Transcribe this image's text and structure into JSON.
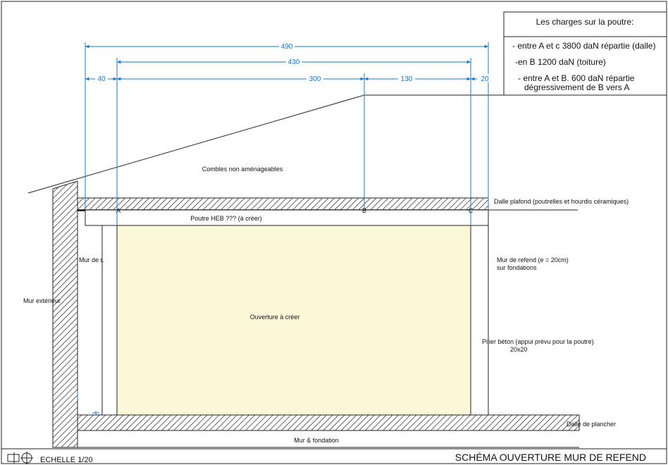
{
  "legend": {
    "title": "Les charges sur la poutre:",
    "line1": "- entre A et c 3800 daN répartie (dalle)",
    "line2": "-en B 1200 daN (toiture)",
    "line3a": "- entre A et B. 600 daN répartie",
    "line3b": "dégressivement de B vers A"
  },
  "dimensions": {
    "d490": "490",
    "d430": "430",
    "d40": "40",
    "d300": "300",
    "d130": "130",
    "d20": "20"
  },
  "points": {
    "a": "A",
    "b": "B",
    "c": "C"
  },
  "labels": {
    "combles": "Combles non aménageables",
    "dalle_plafond": "Dalle plafond (poutrelles et hourdis céramiques)",
    "poutre": "Poutre HEB ??? (à créer)",
    "mur_de_r": "Mur de r.",
    "mur_exterieur": "Mur extérieur",
    "ouverture": "Ouverture à créer",
    "mur_refend_1": "Mur de refend (e = 20cm)",
    "mur_refend_2": "sur fondations",
    "pilier_1": "Pilier béton (appui prévu pour la poutre)",
    "pilier_2": "20x20",
    "dalle_plancher": "Dalle de plancher",
    "mur_fondation": "Mur & fondation"
  },
  "footer": {
    "scale": "ECHELLE 1/20",
    "title": "SCHÉMA OUVERTURE MUR DE REFEND"
  },
  "colors": {
    "dimension": "#1a78c8",
    "opening_fill": "#fbf8d8"
  }
}
